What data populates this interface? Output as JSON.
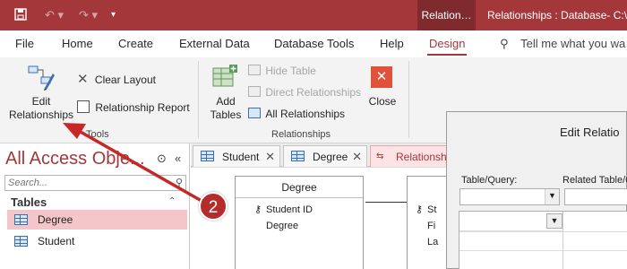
{
  "titlebar": {
    "context_tab": "Relation…",
    "window_title": "Relationships : Database- C:\\U"
  },
  "tabs": [
    "File",
    "Home",
    "Create",
    "External Data",
    "Database Tools",
    "Help",
    "Design"
  ],
  "active_tab": "Design",
  "tell_me": "Tell me what you wa",
  "ribbon": {
    "tools": {
      "edit_relationships": "Edit Relationships",
      "clear_layout": "Clear Layout",
      "relationship_report": "Relationship Report",
      "group_label": "Tools"
    },
    "relationships": {
      "add_tables": "Add Tables",
      "hide_table": "Hide Table",
      "direct_relationships": "Direct Relationships",
      "all_relationships": "All Relationships",
      "close": "Close",
      "group_label": "Relationships"
    }
  },
  "nav": {
    "title": "All Access Obje...",
    "search_placeholder": "Search...",
    "section": "Tables",
    "items": [
      {
        "label": "Degree",
        "selected": true
      },
      {
        "label": "Student",
        "selected": false
      }
    ]
  },
  "doc_tabs": [
    "Student",
    "Degree",
    "Relationshi"
  ],
  "canvas": {
    "table1": {
      "name": "Degree",
      "fields": [
        "Student ID",
        "Degree"
      ]
    },
    "table2": {
      "fields": [
        "St",
        "Fi",
        "La"
      ]
    }
  },
  "dialog": {
    "title": "Edit Relatio",
    "table_query_label": "Table/Query:",
    "related_label": "Related Table/Q"
  },
  "annotation": {
    "step": "2",
    "color": "#c62828"
  },
  "colors": {
    "accent": "#a4373a"
  }
}
